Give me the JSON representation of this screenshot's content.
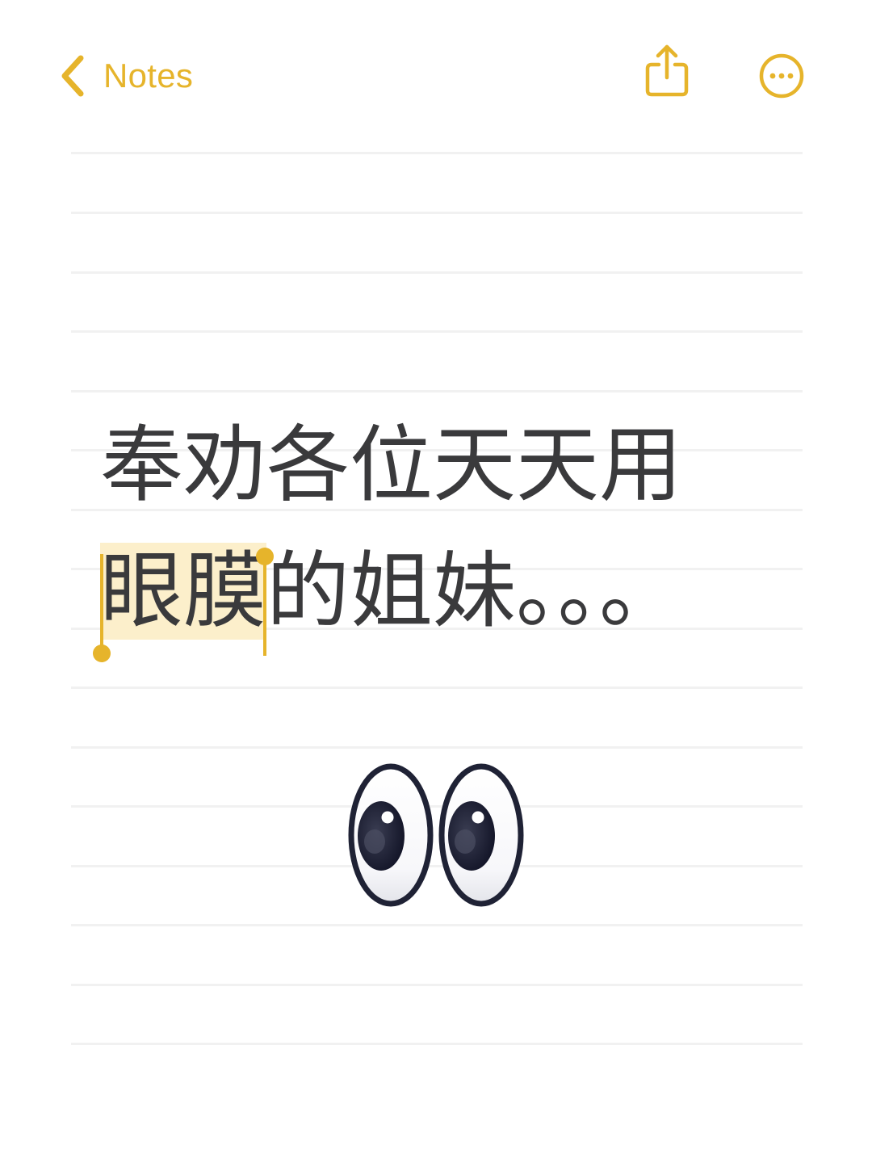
{
  "app": {
    "accent_color": "#e6b42b",
    "text_color": "#3a3a3c",
    "selection_color": "#fcefcb"
  },
  "nav": {
    "back_label": "Notes",
    "back_icon": "chevron-left-icon",
    "share_icon": "share-icon",
    "more_icon": "ellipsis-circle-icon"
  },
  "note": {
    "line1": "奉劝各位天天用",
    "line2_selected": "眼膜",
    "line2_rest": "的姐妹",
    "line2_ellipsis": "。。。",
    "emoji": "eyes-icon"
  }
}
